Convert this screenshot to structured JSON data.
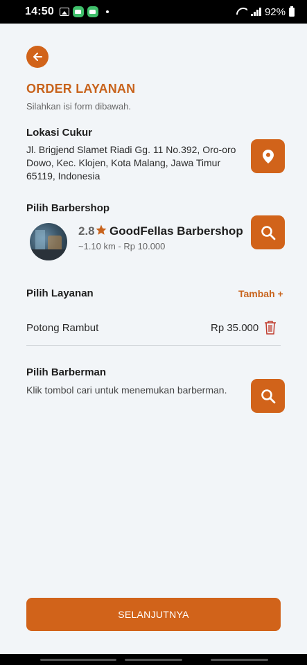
{
  "status_bar": {
    "time": "14:50",
    "battery": "92%"
  },
  "header": {
    "title": "ORDER LAYANAN",
    "subtitle": "Silahkan isi form dibawah."
  },
  "location": {
    "label": "Lokasi Cukur",
    "address": "Jl. Brigjend Slamet Riadi Gg. 11 No.392, Oro-oro Dowo, Kec. Klojen, Kota Malang, Jawa Timur 65119, Indonesia"
  },
  "barbershop": {
    "label": "Pilih Barbershop",
    "rating": "2.8",
    "name": "GoodFellas Barbershop",
    "meta": "~1.10 km - Rp 10.000"
  },
  "services": {
    "label": "Pilih Layanan",
    "add_label": "Tambah +",
    "items": [
      {
        "name": "Potong Rambut",
        "price": "Rp 35.000"
      }
    ]
  },
  "barberman": {
    "label": "Pilih Barberman",
    "hint": "Klik tombol cari untuk menemukan barberman."
  },
  "footer": {
    "next_label": "SELANJUTNYA"
  },
  "colors": {
    "accent": "#d1631a",
    "title": "#c8631c",
    "background": "#f2f5f8"
  }
}
